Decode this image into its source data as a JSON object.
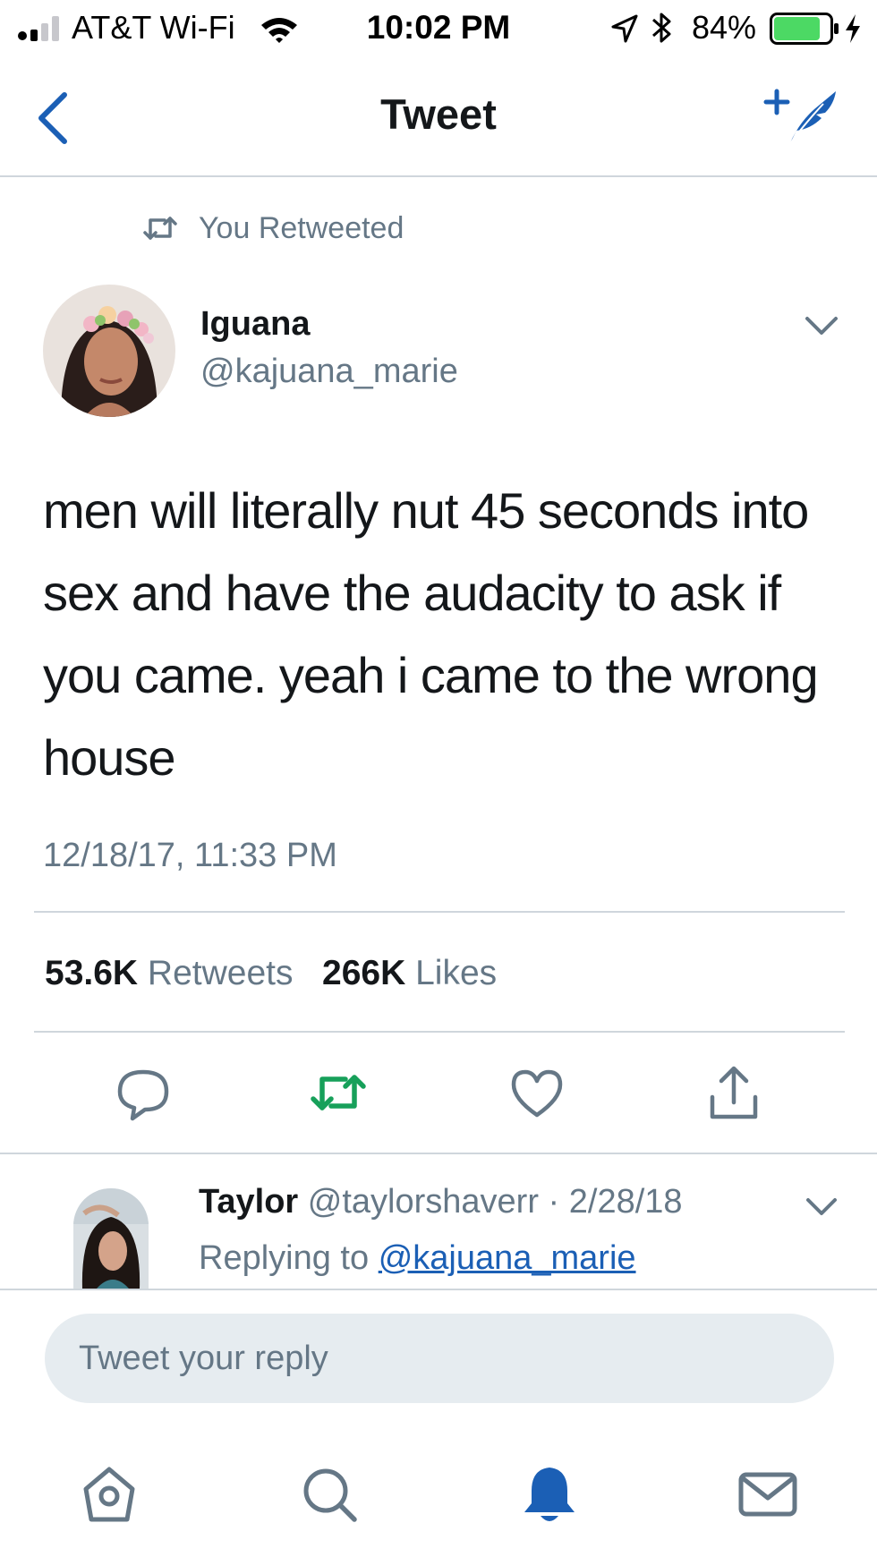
{
  "status_bar": {
    "carrier": "AT&T Wi-Fi",
    "time": "10:02 PM",
    "battery": "84%",
    "battery_level": 0.84,
    "battery_color": "#4cd964"
  },
  "nav": {
    "title": "Tweet"
  },
  "retweet_context": "You Retweeted",
  "tweet": {
    "author_name": "Iguana",
    "author_handle": "@kajuana_marie",
    "text": "men will literally nut 45 seconds into sex and have the audacity to ask if you came. yeah i came to the wrong house",
    "timestamp": "12/18/17, 11:33 PM",
    "retweet_count": "53.6K",
    "retweet_label": "Retweets",
    "like_count": "266K",
    "like_label": "Likes",
    "retweeted": true
  },
  "reply": {
    "name": "Taylor",
    "handle_date": "@taylorshaverr · 2/28/18",
    "replying_prefix": "Replying to",
    "replying_to": "@kajuana_marie"
  },
  "reply_box": {
    "placeholder": "Tweet your reply"
  },
  "icons": {
    "back": "chevron-left-icon",
    "compose": "compose-tweet-icon",
    "reply": "reply-icon",
    "retweet": "retweet-icon",
    "like": "heart-icon",
    "share": "share-icon",
    "tabs": [
      "home-icon",
      "search-icon",
      "notifications-icon",
      "messages-icon"
    ]
  },
  "colors": {
    "accent": "#1b5fb5",
    "retweet_active": "#17bf63",
    "secondary_text": "#657786",
    "divider": "#cfd6dc"
  }
}
